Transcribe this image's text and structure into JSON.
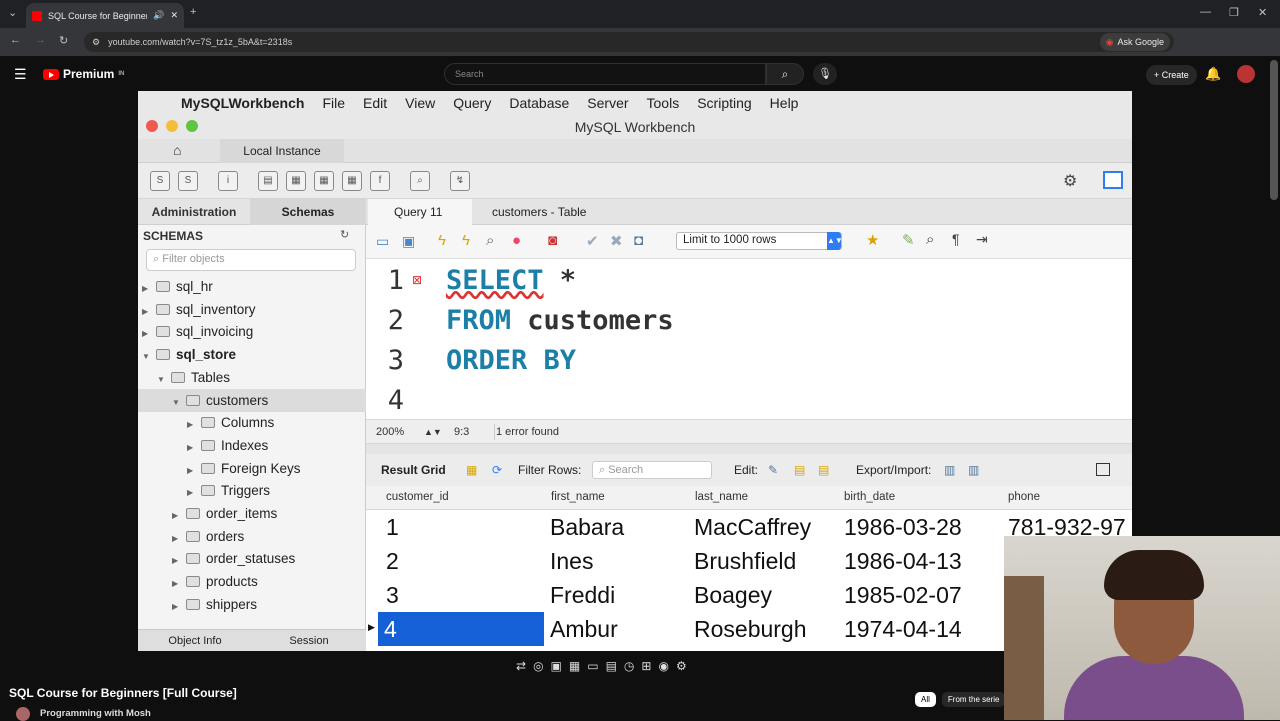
{
  "browser": {
    "tab_title": "SQL Course for Beginners [F",
    "url": "youtube.com/watch?v=7S_tz1z_5bA&t=2318s",
    "ask_google": "Ask Google"
  },
  "youtube": {
    "logo_text": "Premium",
    "logo_badge": "IN",
    "search_placeholder": "Search",
    "create_label": "+ Create",
    "video_title": "SQL Course for Beginners [Full Course]",
    "channel": "Programming with Mosh",
    "chips": [
      "All",
      "From the serie"
    ]
  },
  "workbench": {
    "menu": [
      "MySQLWorkbench",
      "File",
      "Edit",
      "View",
      "Query",
      "Database",
      "Server",
      "Tools",
      "Scripting",
      "Help"
    ],
    "window_title": "MySQL Workbench",
    "instance_tab": "Local Instance",
    "panel_tabs": {
      "administration": "Administration",
      "schemas": "Schemas",
      "query": "Query 11",
      "table": "customers - Table"
    },
    "schemas_header": "SCHEMAS",
    "filter_placeholder": "Filter objects",
    "tree": [
      {
        "label": "sql_hr",
        "level": 0,
        "open": false
      },
      {
        "label": "sql_inventory",
        "level": 0,
        "open": false
      },
      {
        "label": "sql_invoicing",
        "level": 0,
        "open": false
      },
      {
        "label": "sql_store",
        "level": 0,
        "open": true,
        "bold": true
      },
      {
        "label": "Tables",
        "level": 1,
        "open": true
      },
      {
        "label": "customers",
        "level": 2,
        "open": true,
        "selected": true
      },
      {
        "label": "Columns",
        "level": 3,
        "open": false
      },
      {
        "label": "Indexes",
        "level": 3,
        "open": false
      },
      {
        "label": "Foreign Keys",
        "level": 3,
        "open": false
      },
      {
        "label": "Triggers",
        "level": 3,
        "open": false
      },
      {
        "label": "order_items",
        "level": 2,
        "open": false
      },
      {
        "label": "orders",
        "level": 2,
        "open": false
      },
      {
        "label": "order_statuses",
        "level": 2,
        "open": false
      },
      {
        "label": "products",
        "level": 2,
        "open": false
      },
      {
        "label": "shippers",
        "level": 2,
        "open": false
      }
    ],
    "side_bottom": [
      "Object Info",
      "Session"
    ],
    "limit_rows": "Limit to 1000 rows",
    "code_lines": [
      {
        "n": "1",
        "tokens": [
          {
            "t": "SELECT",
            "k": "kw"
          },
          {
            "t": " *",
            "k": "id"
          }
        ]
      },
      {
        "n": "2",
        "tokens": [
          {
            "t": "FROM",
            "k": "kw"
          },
          {
            "t": " customers",
            "k": "id"
          }
        ]
      },
      {
        "n": "3",
        "tokens": [
          {
            "t": "ORDER BY",
            "k": "kw"
          }
        ]
      },
      {
        "n": "4",
        "tokens": []
      }
    ],
    "status": {
      "zoom": "200%",
      "cursor": "9:3",
      "message": "1 error found"
    },
    "result_bar": {
      "result_grid": "Result Grid",
      "filter_rows": "Filter Rows:",
      "search_placeholder": "Search",
      "edit": "Edit:",
      "export": "Export/Import:"
    },
    "columns": [
      "customer_id",
      "first_name",
      "last_name",
      "birth_date",
      "phone"
    ],
    "rows": [
      [
        "1",
        "Babara",
        "MacCaffrey",
        "1986-03-28",
        "781-932-97"
      ],
      [
        "2",
        "Ines",
        "Brushfield",
        "1986-04-13",
        ""
      ],
      [
        "3",
        "Freddi",
        "Boagey",
        "1985-02-07",
        ""
      ],
      [
        "4",
        "Ambur",
        "Roseburgh",
        "1974-04-14",
        ""
      ]
    ]
  }
}
